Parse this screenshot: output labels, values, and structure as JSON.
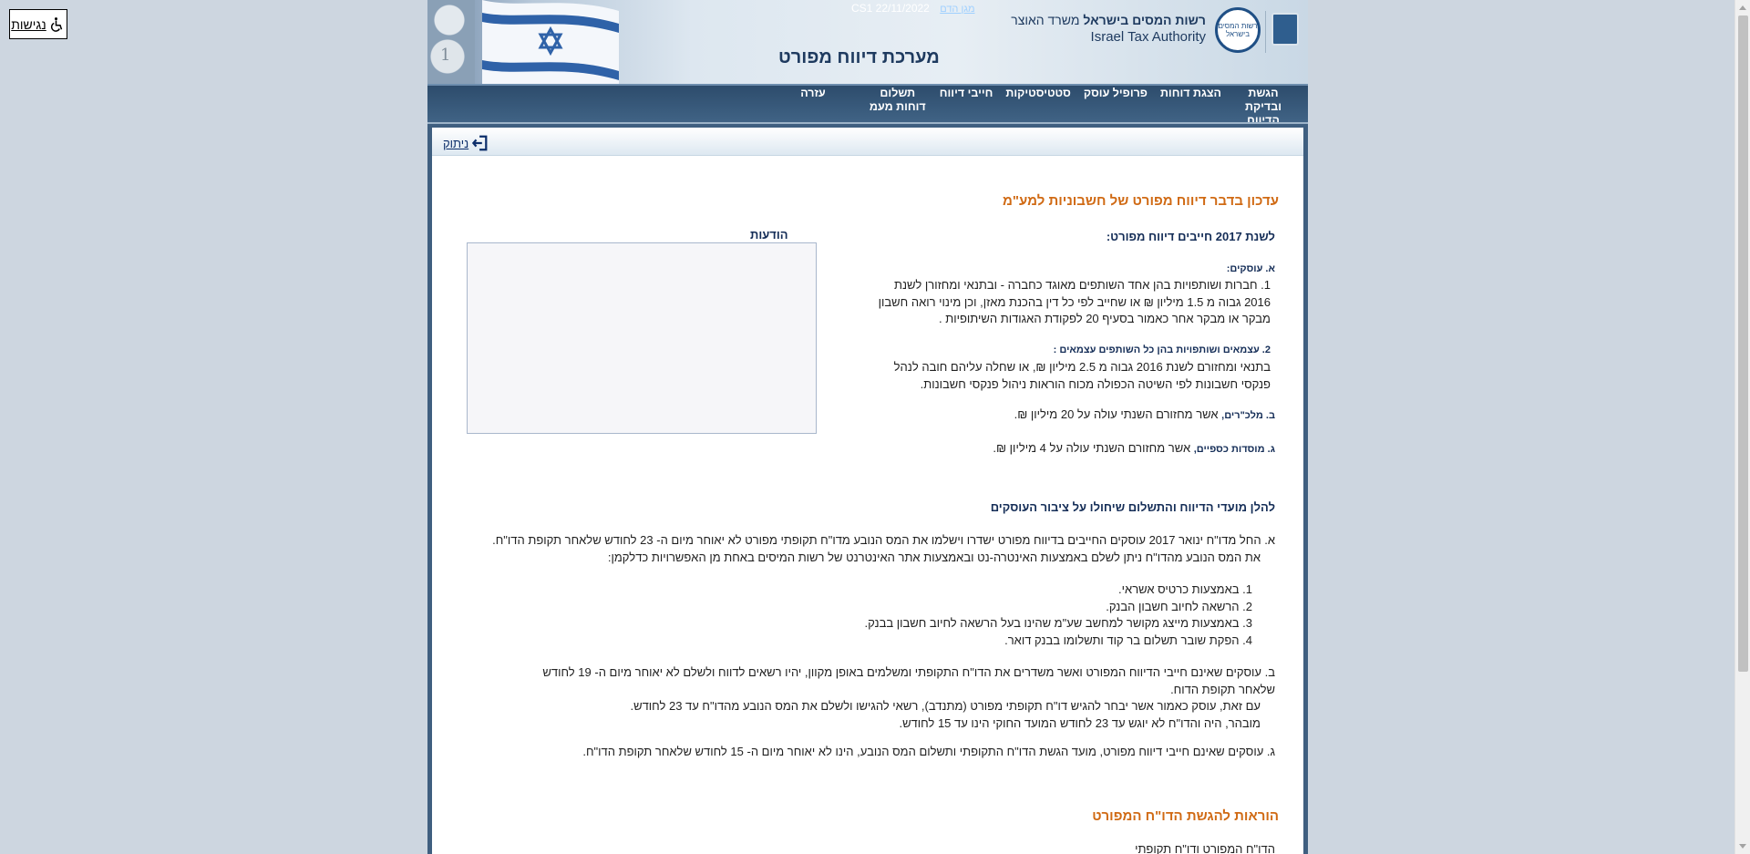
{
  "accessibility": {
    "label": "נגישות",
    "icon": "wheelchair-icon"
  },
  "header": {
    "system_title": "מערכת דיווח מפורט",
    "date_text": "CS1 22/11/2022",
    "date_link": "מגן הדם",
    "org_he_bold": "רשות המסים בישראל",
    "org_he_rest": "משרד האוצר",
    "org_en": "Israel Tax Authority",
    "logo_text": "רשות המסים בישראל",
    "coin_text": "1"
  },
  "nav": {
    "items": [
      {
        "label": "הגשת ובדיקת הדיווח"
      },
      {
        "label": "הצגת דוחות"
      },
      {
        "label": "פרופיל עוסק"
      },
      {
        "label": "סטטיסטיקות"
      },
      {
        "label": "חייבי דיווח"
      },
      {
        "label": "תשלום דוחות מעמ"
      },
      {
        "label": "עזרה"
      }
    ]
  },
  "logout": {
    "label": "ניתוק",
    "icon": "logout-icon"
  },
  "notices": {
    "title": "הודעות"
  },
  "content": {
    "main_title": "עדכון בדבר דיווח מפורט של חשבוניות למע\"מ",
    "year_title": "לשנת 2017 חייבים דיווח מפורט:",
    "section_a_label": "א. עוסקים:",
    "item1": "1. חברות ושותפויות בהן אחד השותפים מאוגד כחברה - ובתנאי ומחזורן לשנת 2016 גבוה מ 1.5 מיליון ₪ או שחייב לפי כל דין בהכנת מאזן, וכן מינוי רואה חשבון מבקר או מבקר אחר כאמור בסעיף 20 לפקודת האגודות השיתופיות .",
    "item2_head": "2. עצמאים ושותפויות בהן כל השותפים עצמאים :",
    "item2": "בתנאי ומחזורם לשנת 2016 גבוה מ 2.5 מיליון ₪, או שחלה עליהם חובה לנהל פנקסי חשבונות לפי השיטה הכפולה מכוח הוראות ניהול פנקסי חשבונות.",
    "b_label": "ב. מלכ\"רים,",
    "b_text": " אשר מחזורם השנתי עולה על 20 מיליון ₪.",
    "g_label": "ג. מוסדות כספיים,",
    "g_text": " אשר מחזורם השנתי עולה על 4 מיליון ₪.",
    "title2": "להלן מועדי הדיווח והתשלום שיחולו על ציבור העוסקים",
    "para_a_1": "א. החל מדו\"ח ינואר 2017 עוסקים החייבים בדיווח מפורט ישדרו וישלמו את המס הנובע מדו\"ח תקופתי מפורט לא יאוחר מיום ה- 23 לחודש שלאחר תקופת הדו\"ח.",
    "para_a_2": "את המס הנובע מהדו\"ח ניתן לשלם באמצעות האינטרה-נט ובאמצעות אתר האינטרנט של רשות המיסים באחת מן האפשרויות כדלקמן:",
    "list": [
      "1. באמצעות כרטיס אשראי.",
      "2. הרשאה לחיוב חשבון הבנק.",
      "3. באמצעות מייצג מקושר למחשב שע\"מ שהינו בעל הרשאה לחיוב חשבון בבנק.",
      "4. הפקת שובר תשלום בר קוד ותשלומו בבנק דואר."
    ],
    "para_b_1": "ב. עוסקים שאינם חייבי הדיווח המפורט ואשר משדרים את הדו\"ח התקופתי ומשלמים באופן מקוון, יהיו רשאים לדווח ולשלם לא יאוחר מיום ה- 19 לחודש שלאחר תקופת הדוח.",
    "para_b_2": "עם זאת, עוסק כאמור אשר יבחר להגיש דו\"ח תקופתי מפורט (מתנדב), רשאי להגישו ולשלם את המס הנובע מהדו\"ח עד 23 לחודש.",
    "para_b_3": "מובהר, היה והדו\"ח לא יוגש עד 23 לחודש המועד החוקי הינו עד 15 לחודש.",
    "para_g": "ג. עוסקים שאינם חייבי דיווח מפורט, מועד הגשת הדו\"ח התקופתי ותשלום המס הנובע, הינו לא יאוחר מיום ה- 15 לחודש שלאחר תקופת הדו\"ח.",
    "title3": "הוראות להגשת הדו\"ח המפורט",
    "last_line": "הדו\"ח המפורט ודו\"ח תקופתי"
  }
}
